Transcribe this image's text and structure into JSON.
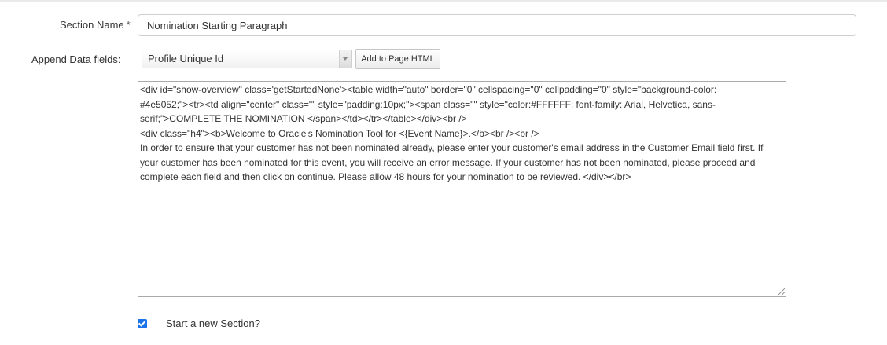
{
  "form": {
    "section_name": {
      "label": "Section Name",
      "required_mark": "*",
      "value": "Nomination Starting Paragraph"
    },
    "append_data": {
      "label": "Append Data fields:",
      "selected": "Profile Unique Id",
      "button_label": "Add to Page HTML"
    },
    "html_content": {
      "lines": [
        "<div id=\"show-overview\" class='getStartedNone'><table width=\"auto\" border=\"0\" cellspacing=\"0\" cellpadding=\"0\" style=\"background-color:",
        "#4e5052;\"><tr><td align=\"center\" class=\"\" style=\"padding:10px;\"><span class=\"\" style=\"color:#FFFFFF; font-family: Arial, Helvetica, sans-",
        "serif;\">COMPLETE THE NOMINATION </span></td></tr></table></div><br />",
        "<div class=\"h4\"><b>Welcome to Oracle's Nomination Tool for <{Event Name}>.</b><br /><br />",
        "In order to ensure that your customer has not been nominated already, please enter your customer's email address in the Customer Email field first. If",
        "your customer has been nominated for this event, you will receive an error message. If your customer has not been nominated, please proceed and",
        "complete each field and then click on continue. Please allow 48 hours for your nomination to be reviewed. </div></br>"
      ]
    },
    "new_section": {
      "label": "Start a new Section?",
      "checked": true
    }
  },
  "colors": {
    "checkbox_accent": "#1a73e8"
  }
}
